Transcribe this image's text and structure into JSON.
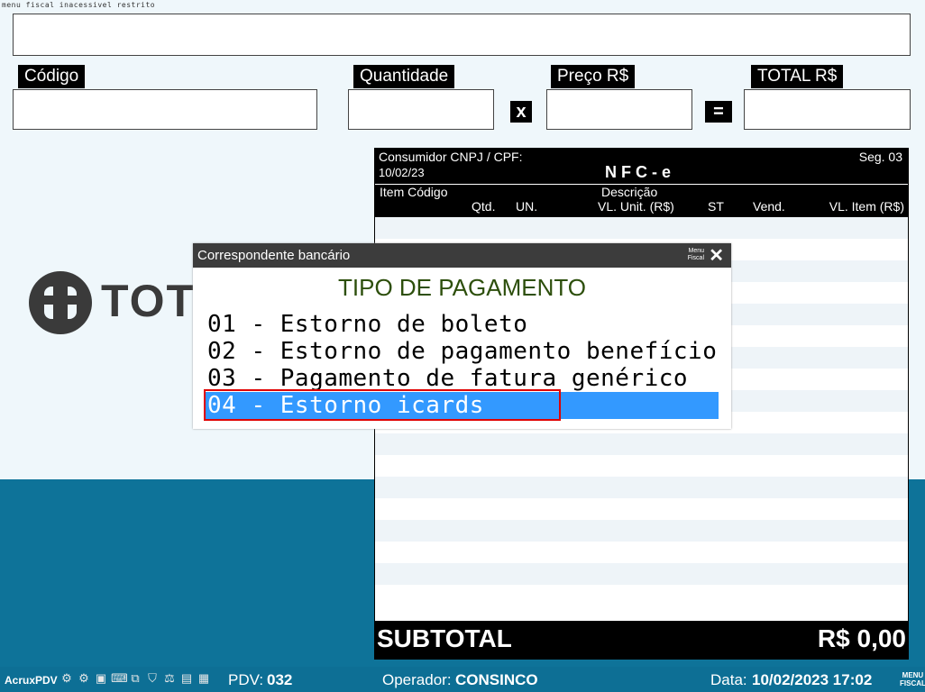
{
  "window": {
    "title": "menu fiscal inacessivel restrito"
  },
  "fields": {
    "codigo_label": "Código",
    "quantidade_label": "Quantidade",
    "preco_label": "Preço R$",
    "total_label": "TOTAL R$",
    "multiply_symbol": "x",
    "equals_symbol": "="
  },
  "logo": {
    "text": "TOTVS"
  },
  "nfce": {
    "consumidor": "Consumidor CNPJ / CPF:",
    "seg": "Seg. 03",
    "date": "10/02/23",
    "title": "N F C - e",
    "col_item_codigo": "Item  Código",
    "col_descricao": "Descrição",
    "col_qtd": "Qtd.",
    "col_un": "UN.",
    "col_vl_unit": "VL. Unit. (R$)",
    "col_st": "ST",
    "col_vend": "Vend.",
    "col_vl_item": "VL. Item (R$)",
    "subtotal_label": "SUBTOTAL",
    "subtotal_value": "R$ 0,00"
  },
  "dialog": {
    "title": "Correspondente bancário",
    "menu_line1": "Menu",
    "menu_line2": "Fiscal",
    "close": "✕",
    "heading": "TIPO DE PAGAMENTO",
    "options": [
      "01 - Estorno de boleto",
      "02 - Estorno de pagamento benefício",
      "03 - Pagamento de fatura genérico",
      "04 - Estorno icards"
    ],
    "selected_index": 3
  },
  "statusbar": {
    "app": "AcruxPDV",
    "pdv_label": "PDV:",
    "pdv_value": "032",
    "operador_label": "Operador:",
    "operador_value": "CONSINCO",
    "data_label": "Data:",
    "data_value": "10/02/2023 17:02",
    "menu_line1": "MENU",
    "menu_line2": "FISCAL"
  },
  "colors": {
    "accent_blue": "#0e7399",
    "selection": "#3399ff",
    "highlight_border": "#e00000",
    "heading_green": "#2d4f0c"
  }
}
